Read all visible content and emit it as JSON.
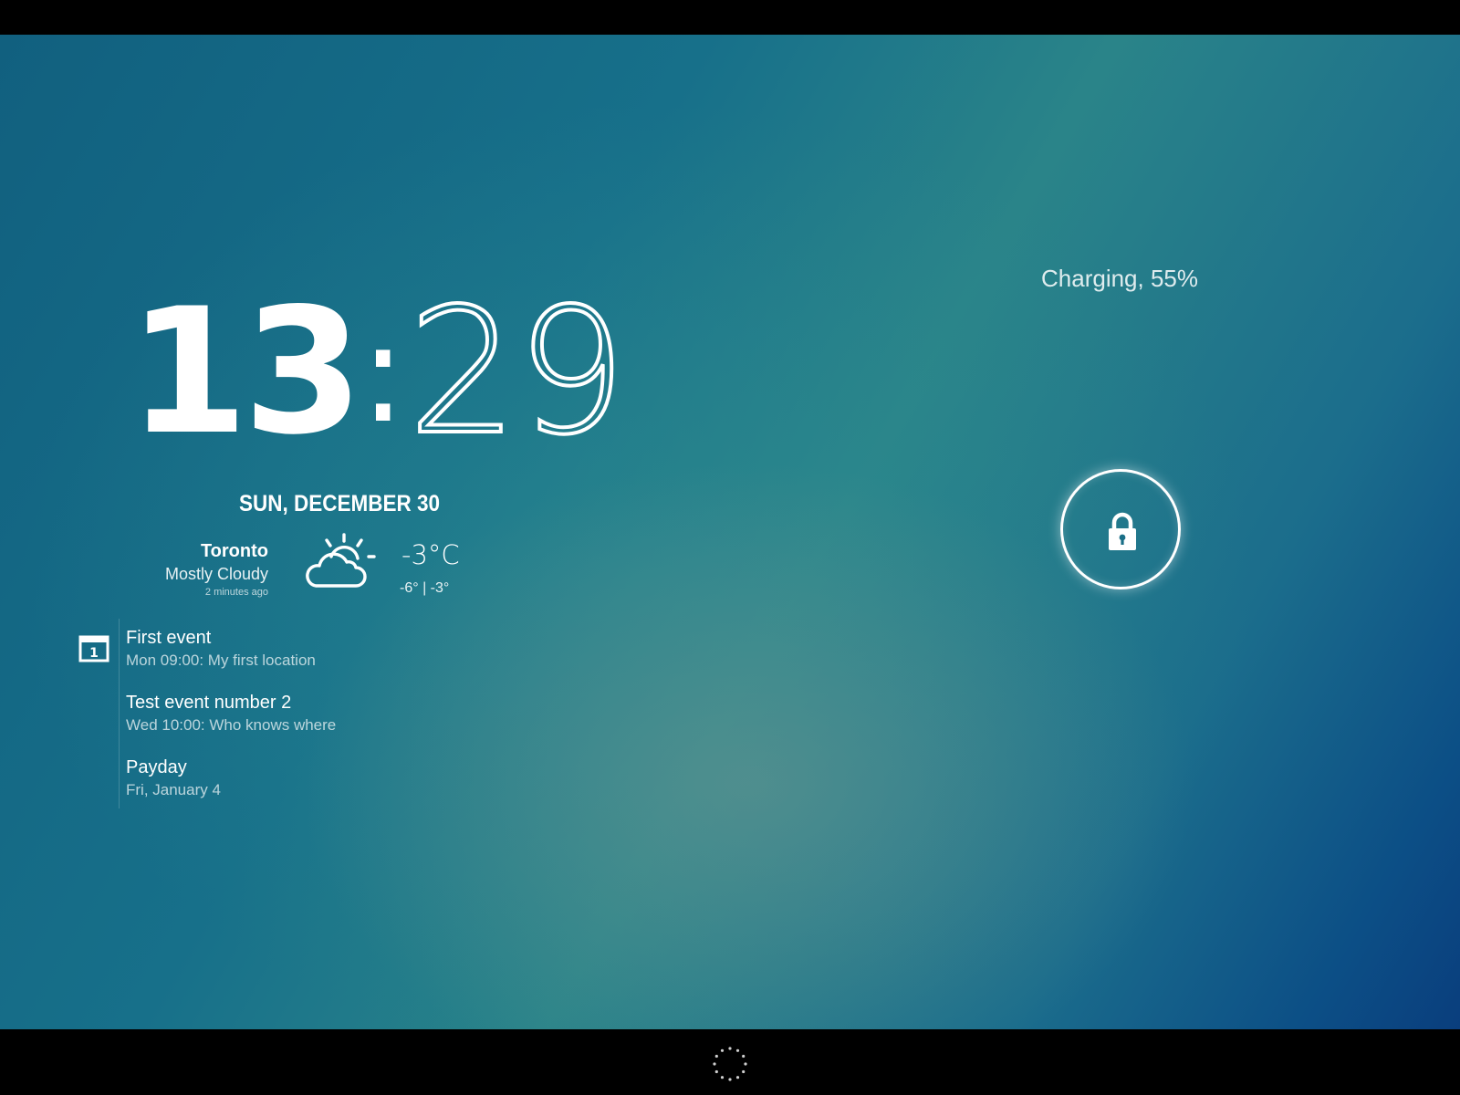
{
  "clock": {
    "hours": "13",
    "colon": ":",
    "minutes": "29"
  },
  "date": "SUN, DECEMBER 30",
  "weather": {
    "city": "Toronto",
    "condition": "Mostly Cloudy",
    "updated": "2 minutes ago",
    "temperature": "-3°C",
    "range": "-6° | -3°",
    "icon": "partly-cloudy-icon"
  },
  "calendar": {
    "icon": "calendar-icon",
    "events": [
      {
        "title": "First event",
        "detail": "Mon 09:00: My first location"
      },
      {
        "title": "Test event number 2",
        "detail": "Wed 10:00: Who knows where"
      },
      {
        "title": "Payday",
        "detail": "Fri, January 4"
      }
    ]
  },
  "status": {
    "charging": "Charging, 55%",
    "battery_level": 55
  },
  "lock": {
    "icon": "lock-icon"
  },
  "colors": {
    "accent": "#ffffff",
    "wallpaper_start": "#11607f",
    "wallpaper_mid": "#2a8489",
    "wallpaper_end": "#0a3e7d"
  }
}
